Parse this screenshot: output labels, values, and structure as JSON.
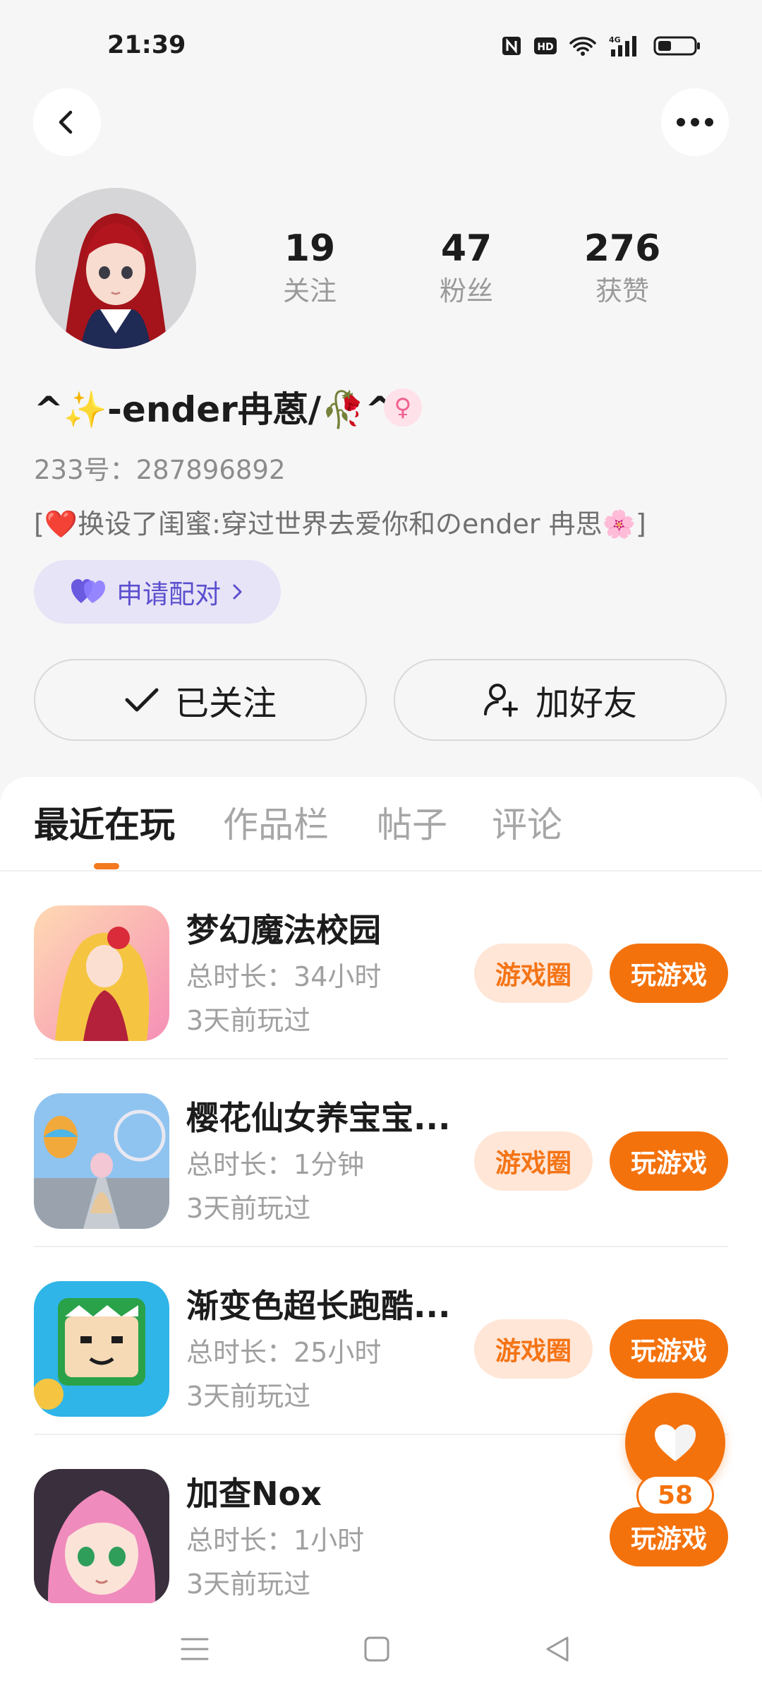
{
  "status_bar": {
    "time": "21:39",
    "network": "4G"
  },
  "header": {
    "back_icon": "chevron-left-icon",
    "more_icon": "more-dots-icon"
  },
  "profile": {
    "stats": [
      {
        "value": "19",
        "label": "关注"
      },
      {
        "value": "47",
        "label": "粉丝"
      },
      {
        "value": "276",
        "label": "获赞"
      }
    ],
    "nickname_prefix": "^✨-ender冉蒽/",
    "nickname_suffix": "^",
    "nickname_emoji": "🥀",
    "gender_symbol": "♀",
    "uid": "233号：287896892",
    "bio_open": "[",
    "bio_heart": "❤️",
    "bio_text": "换设了闺蜜:穿过世界去爱你和のender 冉思",
    "bio_flower": "🌸",
    "bio_close": "]",
    "pair_label": "申请配对",
    "follow_label": "已关注",
    "add_friend_label": "加好友"
  },
  "tabs": [
    {
      "label": "最近在玩",
      "active": true
    },
    {
      "label": "作品栏",
      "active": false
    },
    {
      "label": "帖子",
      "active": false
    },
    {
      "label": "评论",
      "active": false
    }
  ],
  "games": [
    {
      "name": "梦幻魔法校园",
      "duration": "总时长：34小时",
      "last_played": "3天前玩过",
      "circle_label": "游戏圈",
      "play_label": "玩游戏"
    },
    {
      "name": "樱花仙女养宝宝...",
      "duration": "总时长：1分钟",
      "last_played": "3天前玩过",
      "circle_label": "游戏圈",
      "play_label": "玩游戏"
    },
    {
      "name": "渐变色超长跑酷...",
      "duration": "总时长：25小时",
      "last_played": "3天前玩过",
      "circle_label": "游戏圈",
      "play_label": "玩游戏"
    },
    {
      "name": "加查Nox",
      "duration": "总时长：1小时",
      "last_played": "3天前玩过",
      "play_label": "玩游戏"
    }
  ],
  "like_fab": {
    "count": "58"
  },
  "colors": {
    "accent": "#f4720c",
    "pair_text": "#5b4fcf",
    "circle_bg": "#ffe6d7"
  }
}
